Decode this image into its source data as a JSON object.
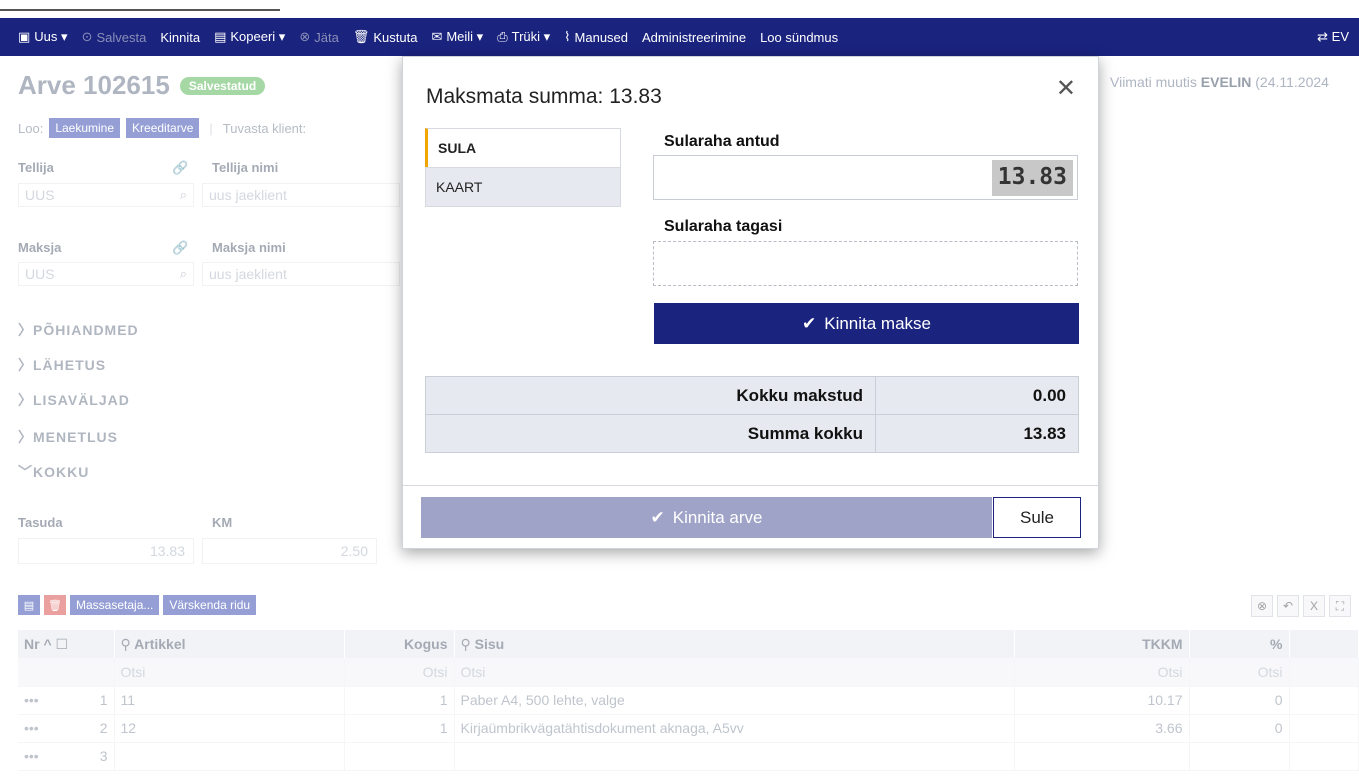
{
  "toolbar": {
    "items": [
      {
        "label": "Uus ▾",
        "icon": "new-document-icon",
        "dim": false
      },
      {
        "label": "Salvesta",
        "icon": "save-icon",
        "dim": true
      },
      {
        "label": "Kinnita",
        "icon": "",
        "dim": false
      },
      {
        "label": "Kopeeri ▾",
        "icon": "copy-icon",
        "dim": false
      },
      {
        "label": "Jäta",
        "icon": "cancel-icon",
        "dim": true
      },
      {
        "label": "Kustuta",
        "icon": "trash-icon",
        "dim": false
      },
      {
        "label": "Meili ▾",
        "icon": "mail-icon",
        "dim": false
      },
      {
        "label": "Trüki ▾",
        "icon": "print-icon",
        "dim": false
      },
      {
        "label": "Manused",
        "icon": "attachment-icon",
        "dim": false
      },
      {
        "label": "Administreerimine",
        "icon": "",
        "dim": false
      },
      {
        "label": "Loo sündmus",
        "icon": "",
        "dim": false
      }
    ],
    "right": "⇄ EV"
  },
  "invoice": {
    "title": "Arve 102615",
    "status": "Salvestatud",
    "modified_prefix": "Viimati muutis",
    "modified_user": "EVELIN",
    "modified_date": "(24.11.2024"
  },
  "loo_row": {
    "label": "Loo:",
    "btn1": "Laekumine",
    "btn2": "Kreeditarve",
    "tuvasta": "Tuvasta klient:"
  },
  "fields": {
    "tellija_label": "Tellija",
    "tellija_value": "UUS",
    "tellija_nimi_label": "Tellija nimi",
    "tellija_nimi_value": "uus jaeklient",
    "maksja_label": "Maksja",
    "maksja_value": "UUS",
    "maksja_nimi_label": "Maksja nimi",
    "maksja_nimi_value": "uus jaeklient"
  },
  "sections": [
    "PÕHIANDMED",
    "LÄHETUS",
    "LISAVÄLJAD",
    "MENETLUS",
    "KOKKU"
  ],
  "totals": {
    "tasuda_label": "Tasuda",
    "tasuda_value": "13.83",
    "km_label": "KM",
    "km_value": "2.50"
  },
  "grid_tools": {
    "mass_btn": "Massasetaja...",
    "refresh_btn": "Värskenda ridu"
  },
  "grid": {
    "headers": [
      "Nr ^",
      "Artikkel",
      "Kogus",
      "Sisu",
      "TKKM",
      "%"
    ],
    "filter_placeholder": "Otsi",
    "rows": [
      {
        "nr": "1",
        "artikkel": "11",
        "kogus": "1",
        "sisu": "Paber A4, 500 lehte, valge",
        "tkkm": "10.17",
        "pct": "0"
      },
      {
        "nr": "2",
        "artikkel": "12",
        "kogus": "1",
        "sisu": "Kirjaümbrikvägatähtisdokument aknaga, A5vv",
        "tkkm": "3.66",
        "pct": "0"
      },
      {
        "nr": "3",
        "artikkel": "",
        "kogus": "",
        "sisu": "",
        "tkkm": "",
        "pct": ""
      }
    ],
    "row_dots": "•••"
  },
  "modal": {
    "title": "Maksmata summa: 13.83",
    "close_symbol": "✕",
    "tabs": [
      "SULA",
      "KAART"
    ],
    "cash_given_label": "Sularaha antud",
    "cash_given_value": "13.83",
    "cash_back_label": "Sularaha tagasi",
    "cash_back_value": "",
    "confirm_payment": "Kinnita makse",
    "sums": [
      {
        "label": "Kokku makstud",
        "value": "0.00"
      },
      {
        "label": "Summa kokku",
        "value": "13.83"
      }
    ],
    "confirm_invoice": "Kinnita arve",
    "close_button": "Sule"
  },
  "colors": {
    "primary": "#1a237e",
    "accent_tab": "#f0a500",
    "status_green": "#5cb85c",
    "disabled_button": "#9fa3c8"
  }
}
